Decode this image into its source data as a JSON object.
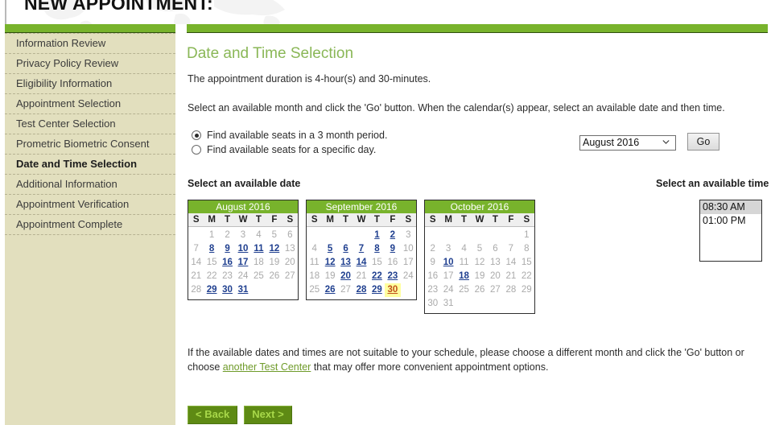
{
  "header": {
    "title": "NEW APPOINTMENT:"
  },
  "sidebar": {
    "items": [
      {
        "label": "Information Review",
        "current": false
      },
      {
        "label": "Privacy Policy Review",
        "current": false
      },
      {
        "label": "Eligibility Information",
        "current": false
      },
      {
        "label": "Appointment Selection",
        "current": false
      },
      {
        "label": "Test Center Selection",
        "current": false
      },
      {
        "label": "Prometric Biometric Consent",
        "current": false
      },
      {
        "label": "Date and Time Selection",
        "current": true
      },
      {
        "label": "Additional Information",
        "current": false
      },
      {
        "label": "Appointment Verification",
        "current": false
      },
      {
        "label": "Appointment Complete",
        "current": false
      }
    ]
  },
  "main": {
    "page_title": "Date and Time Selection",
    "duration_text": "The appointment duration is 4-hour(s) and 30-minutes.",
    "instruction_text": "Select an available month and click the 'Go' button. When the calendar(s) appear, select an available date and then time.",
    "search_options": [
      {
        "label": "Find available seats in a 3 month period.",
        "selected": true
      },
      {
        "label": "Find available seats for a specific day.",
        "selected": false
      }
    ],
    "month_select": {
      "value": "August 2016",
      "options": [
        "August 2016",
        "September 2016",
        "October 2016"
      ]
    },
    "go_label": "Go",
    "date_label": "Select an available date",
    "time_label": "Select an available time",
    "footer_text_before": "If the available dates and times are not suitable to your schedule, please choose a different month and click the 'Go' button or choose ",
    "footer_link": "another Test Center",
    "footer_text_after": " that may offer more convenient appointment options.",
    "back_label": "< Back",
    "next_label": "Next >"
  },
  "calendars": [
    {
      "title": "August 2016",
      "dow": [
        "S",
        "M",
        "T",
        "W",
        "T",
        "F",
        "S"
      ],
      "lead_blanks": 1,
      "days": [
        {
          "d": 1,
          "s": "off"
        },
        {
          "d": 2,
          "s": "off"
        },
        {
          "d": 3,
          "s": "off"
        },
        {
          "d": 4,
          "s": "off"
        },
        {
          "d": 5,
          "s": "off"
        },
        {
          "d": 6,
          "s": "off"
        },
        {
          "d": 7,
          "s": "off"
        },
        {
          "d": 8,
          "s": "link"
        },
        {
          "d": 9,
          "s": "link"
        },
        {
          "d": 10,
          "s": "link"
        },
        {
          "d": 11,
          "s": "link"
        },
        {
          "d": 12,
          "s": "link"
        },
        {
          "d": 13,
          "s": "off"
        },
        {
          "d": 14,
          "s": "off"
        },
        {
          "d": 15,
          "s": "off"
        },
        {
          "d": 16,
          "s": "link"
        },
        {
          "d": 17,
          "s": "link"
        },
        {
          "d": 18,
          "s": "off"
        },
        {
          "d": 19,
          "s": "off"
        },
        {
          "d": 20,
          "s": "off"
        },
        {
          "d": 21,
          "s": "off"
        },
        {
          "d": 22,
          "s": "off"
        },
        {
          "d": 23,
          "s": "off"
        },
        {
          "d": 24,
          "s": "off"
        },
        {
          "d": 25,
          "s": "off"
        },
        {
          "d": 26,
          "s": "off"
        },
        {
          "d": 27,
          "s": "off"
        },
        {
          "d": 28,
          "s": "off"
        },
        {
          "d": 29,
          "s": "link"
        },
        {
          "d": 30,
          "s": "link"
        },
        {
          "d": 31,
          "s": "link"
        }
      ]
    },
    {
      "title": "September 2016",
      "dow": [
        "S",
        "M",
        "T",
        "W",
        "T",
        "F",
        "S"
      ],
      "lead_blanks": 4,
      "days": [
        {
          "d": 1,
          "s": "link"
        },
        {
          "d": 2,
          "s": "link"
        },
        {
          "d": 3,
          "s": "off"
        },
        {
          "d": 4,
          "s": "off"
        },
        {
          "d": 5,
          "s": "link"
        },
        {
          "d": 6,
          "s": "link"
        },
        {
          "d": 7,
          "s": "link"
        },
        {
          "d": 8,
          "s": "link"
        },
        {
          "d": 9,
          "s": "link"
        },
        {
          "d": 10,
          "s": "off"
        },
        {
          "d": 11,
          "s": "off"
        },
        {
          "d": 12,
          "s": "link"
        },
        {
          "d": 13,
          "s": "link"
        },
        {
          "d": 14,
          "s": "link"
        },
        {
          "d": 15,
          "s": "off"
        },
        {
          "d": 16,
          "s": "off"
        },
        {
          "d": 17,
          "s": "off"
        },
        {
          "d": 18,
          "s": "off"
        },
        {
          "d": 19,
          "s": "off"
        },
        {
          "d": 20,
          "s": "link"
        },
        {
          "d": 21,
          "s": "off"
        },
        {
          "d": 22,
          "s": "link"
        },
        {
          "d": 23,
          "s": "link"
        },
        {
          "d": 24,
          "s": "off"
        },
        {
          "d": 25,
          "s": "off"
        },
        {
          "d": 26,
          "s": "link"
        },
        {
          "d": 27,
          "s": "off"
        },
        {
          "d": 28,
          "s": "link"
        },
        {
          "d": 29,
          "s": "link"
        },
        {
          "d": 30,
          "s": "sel"
        }
      ]
    },
    {
      "title": "October 2016",
      "dow": [
        "S",
        "M",
        "T",
        "W",
        "T",
        "F",
        "S"
      ],
      "lead_blanks": 6,
      "days": [
        {
          "d": 1,
          "s": "off"
        },
        {
          "d": 2,
          "s": "off"
        },
        {
          "d": 3,
          "s": "off"
        },
        {
          "d": 4,
          "s": "off"
        },
        {
          "d": 5,
          "s": "off"
        },
        {
          "d": 6,
          "s": "off"
        },
        {
          "d": 7,
          "s": "off"
        },
        {
          "d": 8,
          "s": "off"
        },
        {
          "d": 9,
          "s": "off"
        },
        {
          "d": 10,
          "s": "link"
        },
        {
          "d": 11,
          "s": "off"
        },
        {
          "d": 12,
          "s": "off"
        },
        {
          "d": 13,
          "s": "off"
        },
        {
          "d": 14,
          "s": "off"
        },
        {
          "d": 15,
          "s": "off"
        },
        {
          "d": 16,
          "s": "off"
        },
        {
          "d": 17,
          "s": "off"
        },
        {
          "d": 18,
          "s": "link"
        },
        {
          "d": 19,
          "s": "off"
        },
        {
          "d": 20,
          "s": "off"
        },
        {
          "d": 21,
          "s": "off"
        },
        {
          "d": 22,
          "s": "off"
        },
        {
          "d": 23,
          "s": "off"
        },
        {
          "d": 24,
          "s": "off"
        },
        {
          "d": 25,
          "s": "off"
        },
        {
          "d": 26,
          "s": "off"
        },
        {
          "d": 27,
          "s": "off"
        },
        {
          "d": 28,
          "s": "off"
        },
        {
          "d": 29,
          "s": "off"
        },
        {
          "d": 30,
          "s": "off"
        },
        {
          "d": 31,
          "s": "off"
        }
      ]
    }
  ],
  "times": [
    {
      "label": "08:30 AM",
      "selected": true
    },
    {
      "label": "01:00 PM",
      "selected": false
    }
  ],
  "colors": {
    "green_bar": "#78b32c",
    "sidebar_bg": "#e2dfbe",
    "title_green": "#8ab757",
    "link_blue": "#1f3f8f",
    "selected_day_bg": "#ffff9f",
    "selected_day_text": "#c0501a",
    "button_green": "#5e8a14",
    "button_text": "#a8d84a"
  }
}
